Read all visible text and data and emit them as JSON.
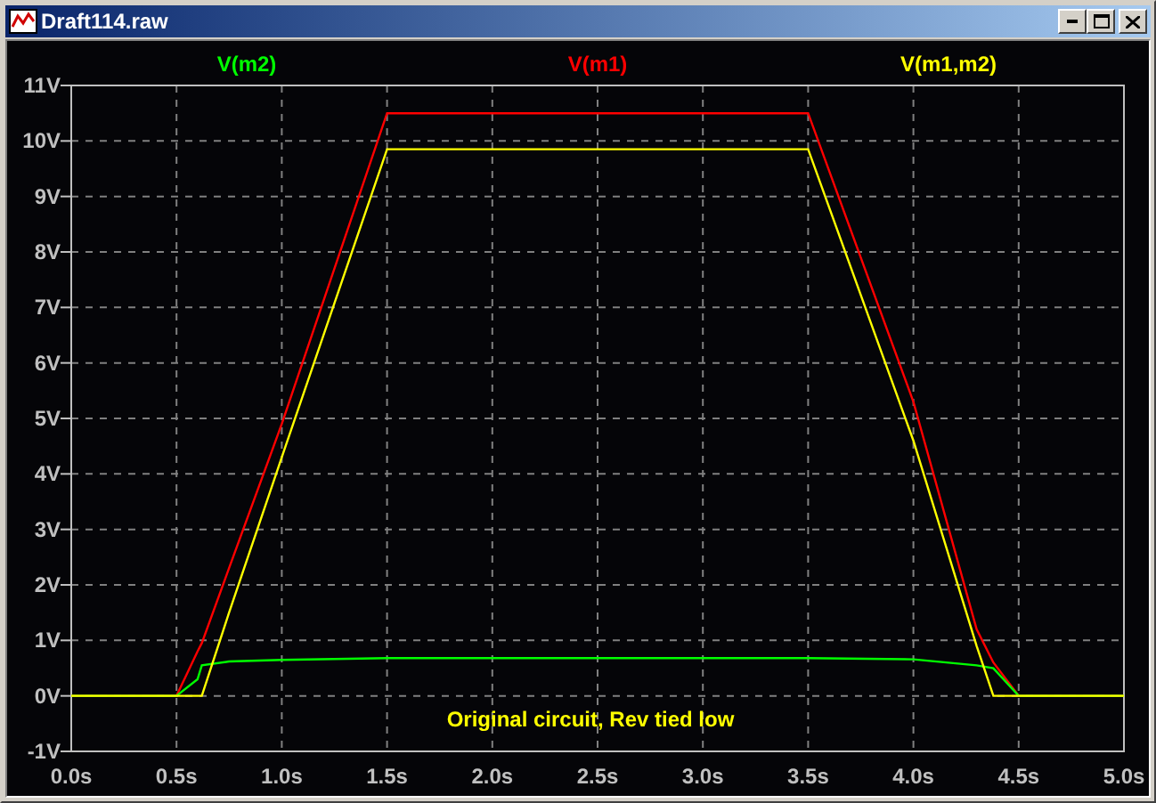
{
  "window": {
    "title": "Draft114.raw"
  },
  "plot": {
    "chart_data": {
      "type": "line",
      "x": [
        0,
        0.5,
        0.6,
        0.62,
        0.75,
        1.0,
        1.5,
        3.5,
        4.0,
        4.3,
        4.38,
        4.5,
        5.0
      ],
      "series": [
        {
          "name": "V(m2)",
          "color": "#00ff00",
          "values": [
            0,
            0,
            0.3,
            0.55,
            0.62,
            0.65,
            0.68,
            0.68,
            0.66,
            0.55,
            0.5,
            0,
            0
          ]
        },
        {
          "name": "V(m1)",
          "color": "#ff0000",
          "values": [
            0,
            0,
            0.8,
            0.95,
            2.3,
            4.9,
            10.5,
            10.5,
            5.3,
            1.2,
            0.6,
            0,
            0
          ]
        },
        {
          "name": "V(m1,m2)",
          "color": "#ffff00",
          "values": [
            0,
            0,
            0,
            0,
            1.5,
            4.3,
            9.85,
            9.85,
            4.6,
            0.9,
            0,
            0,
            0
          ]
        }
      ],
      "xlim": [
        0,
        5
      ],
      "ylim": [
        -1,
        11
      ],
      "xticks": [
        {
          "value": 0,
          "label": "0.0s"
        },
        {
          "value": 0.5,
          "label": "0.5s"
        },
        {
          "value": 1,
          "label": "1.0s"
        },
        {
          "value": 1.5,
          "label": "1.5s"
        },
        {
          "value": 2,
          "label": "2.0s"
        },
        {
          "value": 2.5,
          "label": "2.5s"
        },
        {
          "value": 3,
          "label": "3.0s"
        },
        {
          "value": 3.5,
          "label": "3.5s"
        },
        {
          "value": 4,
          "label": "4.0s"
        },
        {
          "value": 4.5,
          "label": "4.5s"
        },
        {
          "value": 5,
          "label": "5.0s"
        }
      ],
      "yticks": [
        {
          "value": -1,
          "label": "-1V"
        },
        {
          "value": 0,
          "label": "0V"
        },
        {
          "value": 1,
          "label": "1V"
        },
        {
          "value": 2,
          "label": "2V"
        },
        {
          "value": 3,
          "label": "3V"
        },
        {
          "value": 4,
          "label": "4V"
        },
        {
          "value": 5,
          "label": "5V"
        },
        {
          "value": 6,
          "label": "6V"
        },
        {
          "value": 7,
          "label": "7V"
        },
        {
          "value": 8,
          "label": "8V"
        },
        {
          "value": 9,
          "label": "9V"
        },
        {
          "value": 10,
          "label": "10V"
        },
        {
          "value": 11,
          "label": "11V"
        }
      ],
      "grid": true,
      "annotations": [
        "Original circuit, Rev tied low"
      ]
    }
  }
}
